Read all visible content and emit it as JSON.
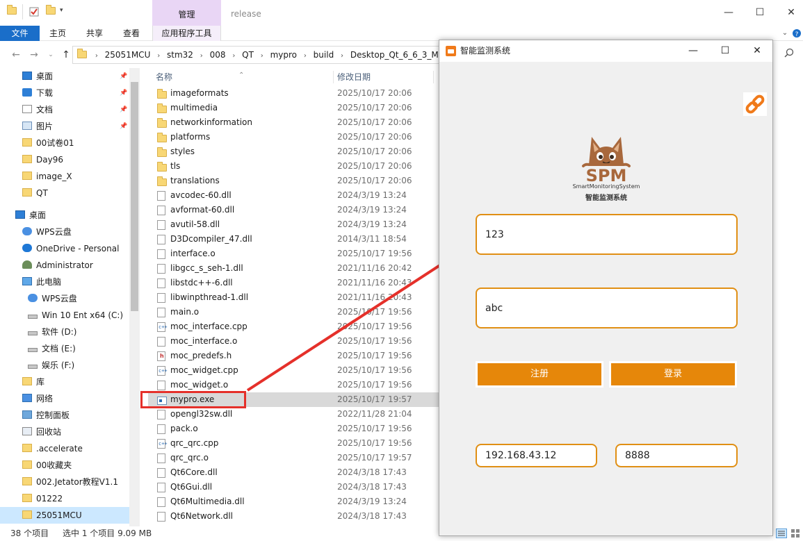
{
  "explorer": {
    "title": "release",
    "context_tab_group": "管理",
    "window_buttons": {
      "minimize": "—",
      "maximize": "☐",
      "close": "✕"
    },
    "ribbon_tabs": [
      "文件",
      "主页",
      "共享",
      "查看",
      "应用程序工具"
    ],
    "address_crumbs": [
      "25051MCU",
      "stm32",
      "008",
      "QT",
      "mypro",
      "build",
      "Desktop_Qt_6_6_3_Min"
    ],
    "nav_items": [
      {
        "label": "桌面",
        "icon": "desktop-icon",
        "pinned": true
      },
      {
        "label": "下载",
        "icon": "download-icon",
        "pinned": true
      },
      {
        "label": "文档",
        "icon": "document-icon",
        "pinned": true
      },
      {
        "label": "图片",
        "icon": "picture-icon",
        "pinned": true
      },
      {
        "label": "00试卷01",
        "icon": "folder-icon",
        "pinned": false
      },
      {
        "label": "Day96",
        "icon": "folder-icon",
        "pinned": false
      },
      {
        "label": "image_X",
        "icon": "folder-icon",
        "pinned": false
      },
      {
        "label": "QT",
        "icon": "folder-icon",
        "pinned": false
      },
      {
        "label": "桌面",
        "icon": "desktop-icon",
        "pinned": false
      },
      {
        "label": "WPS云盘",
        "icon": "cloud-icon",
        "pinned": false
      },
      {
        "label": "OneDrive - Personal",
        "icon": "onedrive-icon",
        "pinned": false
      },
      {
        "label": "Administrator",
        "icon": "user-icon",
        "pinned": false
      },
      {
        "label": "此电脑",
        "icon": "computer-icon",
        "pinned": false
      },
      {
        "label": "WPS云盘",
        "icon": "cloud-icon",
        "pinned": false
      },
      {
        "label": "Win 10 Ent x64 (C:)",
        "icon": "drive-icon",
        "pinned": false
      },
      {
        "label": "软件 (D:)",
        "icon": "drive-icon",
        "pinned": false
      },
      {
        "label": "文档 (E:)",
        "icon": "drive-icon",
        "pinned": false
      },
      {
        "label": "娱乐 (F:)",
        "icon": "drive-icon",
        "pinned": false
      },
      {
        "label": "库",
        "icon": "library-icon",
        "pinned": false
      },
      {
        "label": "网络",
        "icon": "network-icon",
        "pinned": false
      },
      {
        "label": "控制面板",
        "icon": "control-panel-icon",
        "pinned": false
      },
      {
        "label": "回收站",
        "icon": "recycle-bin-icon",
        "pinned": false
      },
      {
        "label": ".accelerate",
        "icon": "folder-icon",
        "pinned": false
      },
      {
        "label": "00收藏夹",
        "icon": "folder-icon",
        "pinned": false
      },
      {
        "label": "002.Jetator教程V1.1",
        "icon": "folder-icon",
        "pinned": false
      },
      {
        "label": "01222",
        "icon": "folder-icon",
        "pinned": false
      },
      {
        "label": "25051MCU",
        "icon": "folder-icon",
        "pinned": false
      }
    ],
    "columns": {
      "name": "名称",
      "modified": "修改日期"
    },
    "files": [
      {
        "name": "imageformats",
        "date": "2025/10/17 20:06",
        "type": "folder"
      },
      {
        "name": "multimedia",
        "date": "2025/10/17 20:06",
        "type": "folder"
      },
      {
        "name": "networkinformation",
        "date": "2025/10/17 20:06",
        "type": "folder"
      },
      {
        "name": "platforms",
        "date": "2025/10/17 20:06",
        "type": "folder"
      },
      {
        "name": "styles",
        "date": "2025/10/17 20:06",
        "type": "folder"
      },
      {
        "name": "tls",
        "date": "2025/10/17 20:06",
        "type": "folder"
      },
      {
        "name": "translations",
        "date": "2025/10/17 20:06",
        "type": "folder"
      },
      {
        "name": "avcodec-60.dll",
        "date": "2024/3/19 13:24",
        "type": "file"
      },
      {
        "name": "avformat-60.dll",
        "date": "2024/3/19 13:24",
        "type": "file"
      },
      {
        "name": "avutil-58.dll",
        "date": "2024/3/19 13:24",
        "type": "file"
      },
      {
        "name": "D3Dcompiler_47.dll",
        "date": "2014/3/11 18:54",
        "type": "file"
      },
      {
        "name": "interface.o",
        "date": "2025/10/17 19:56",
        "type": "file"
      },
      {
        "name": "libgcc_s_seh-1.dll",
        "date": "2021/11/16 20:42",
        "type": "file"
      },
      {
        "name": "libstdc++-6.dll",
        "date": "2021/11/16 20:43",
        "type": "file"
      },
      {
        "name": "libwinpthread-1.dll",
        "date": "2021/11/16 20:43",
        "type": "file"
      },
      {
        "name": "main.o",
        "date": "2025/10/17 19:56",
        "type": "file"
      },
      {
        "name": "moc_interface.cpp",
        "date": "2025/10/17 19:56",
        "type": "cpp"
      },
      {
        "name": "moc_interface.o",
        "date": "2025/10/17 19:56",
        "type": "file"
      },
      {
        "name": "moc_predefs.h",
        "date": "2025/10/17 19:56",
        "type": "h"
      },
      {
        "name": "moc_widget.cpp",
        "date": "2025/10/17 19:56",
        "type": "cpp"
      },
      {
        "name": "moc_widget.o",
        "date": "2025/10/17 19:56",
        "type": "file"
      },
      {
        "name": "mypro.exe",
        "date": "2025/10/17 19:57",
        "type": "exe",
        "selected": true
      },
      {
        "name": "opengl32sw.dll",
        "date": "2022/11/28 21:04",
        "type": "file"
      },
      {
        "name": "pack.o",
        "date": "2025/10/17 19:56",
        "type": "file"
      },
      {
        "name": "qrc_qrc.cpp",
        "date": "2025/10/17 19:56",
        "type": "cpp"
      },
      {
        "name": "qrc_qrc.o",
        "date": "2025/10/17 19:57",
        "type": "file"
      },
      {
        "name": "Qt6Core.dll",
        "date": "2024/3/18 17:43",
        "type": "file"
      },
      {
        "name": "Qt6Gui.dll",
        "date": "2024/3/18 17:43",
        "type": "file"
      },
      {
        "name": "Qt6Multimedia.dll",
        "date": "2024/3/19 13:24",
        "type": "file"
      },
      {
        "name": "Qt6Network.dll",
        "date": "2024/3/18 17:43",
        "type": "file"
      }
    ],
    "status": {
      "count": "38 个项目",
      "selection": "选中 1 个项目  9.09 MB"
    }
  },
  "app": {
    "title": "智能监测系统",
    "logo_main": "SPM",
    "logo_en": "SmartMonitoringSystem",
    "logo_cn": "智能监测系统",
    "username": "123",
    "password": "abc",
    "register_label": "注册",
    "login_label": "登录",
    "ip": "192.168.43.12",
    "port": "8888",
    "colors": {
      "accent": "#e6870a",
      "border": "#e08f14"
    }
  }
}
